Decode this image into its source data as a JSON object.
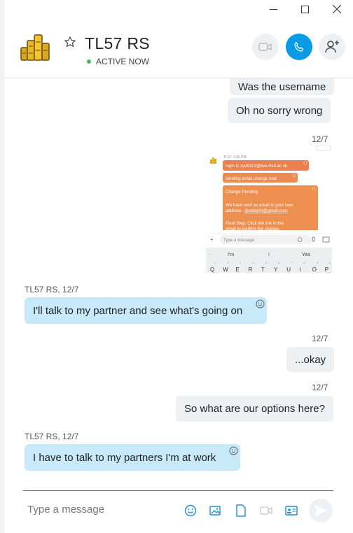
{
  "window": {
    "minimize_icon": "minimize-icon",
    "maximize_icon": "maximize-icon",
    "close_icon": "close-icon"
  },
  "header": {
    "contact_name": "TL57 RS",
    "status": "ACTIVE NOW",
    "status_color": "#47b55e",
    "call_button_color": "#0a9be6"
  },
  "messages": [
    {
      "direction": "out",
      "text": "Was the username"
    },
    {
      "direction": "out",
      "text": "Oh no sorry wrong"
    },
    {
      "direction": "out",
      "stamp": "12/7",
      "type": "image"
    },
    {
      "direction": "in",
      "sender": "TL57 RS, 12/7",
      "text": "I'll talk to my partner and see what's going on"
    },
    {
      "direction": "out",
      "stamp": "12/7",
      "text": "...okay"
    },
    {
      "direction": "out",
      "stamp": "12/7",
      "text": "So what are our options here?"
    },
    {
      "direction": "in",
      "sender": "TL57 RS, 12/7",
      "text": "I have to talk to my partners I'm at work"
    }
  ],
  "screenshot": {
    "time": "TL57, 4:31 PM",
    "bubbles": [
      "login is zyvb322@live.rhul.ac.uk",
      "sending email change now",
      "Change Pending",
      "We have sent an email to your new address - jbsdely93@gmail.com.",
      "Final Step: Click the link in the email to confirm the change."
    ],
    "input_placeholder": "Type a message",
    "suggestions": [
      "I'm",
      "I",
      "Yea"
    ],
    "key_numbers": [
      "1",
      "2",
      "3",
      "4",
      "5",
      "6",
      "7",
      "8",
      "9",
      "0"
    ],
    "key_letters": [
      "Q",
      "W",
      "E",
      "R",
      "T",
      "Y",
      "U",
      "I",
      "O",
      "P"
    ]
  },
  "composer": {
    "placeholder": "Type a message"
  }
}
